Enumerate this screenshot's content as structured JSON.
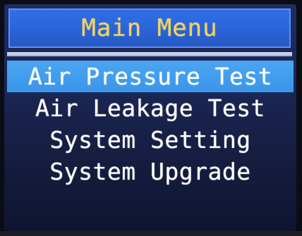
{
  "title_bar": {
    "title": "Main Menu"
  },
  "menu": {
    "items": [
      {
        "label": "Air Pressure Test",
        "selected": true
      },
      {
        "label": "Air Leakage Test",
        "selected": false
      },
      {
        "label": "System Setting",
        "selected": false
      },
      {
        "label": "System Upgrade",
        "selected": false
      }
    ]
  },
  "colors": {
    "title_background": "#2f6fe8",
    "title_text": "#f4d35a",
    "selection_highlight": "#4aa6f3",
    "menu_text": "#ffffff",
    "screen_background": "#1b2552"
  }
}
